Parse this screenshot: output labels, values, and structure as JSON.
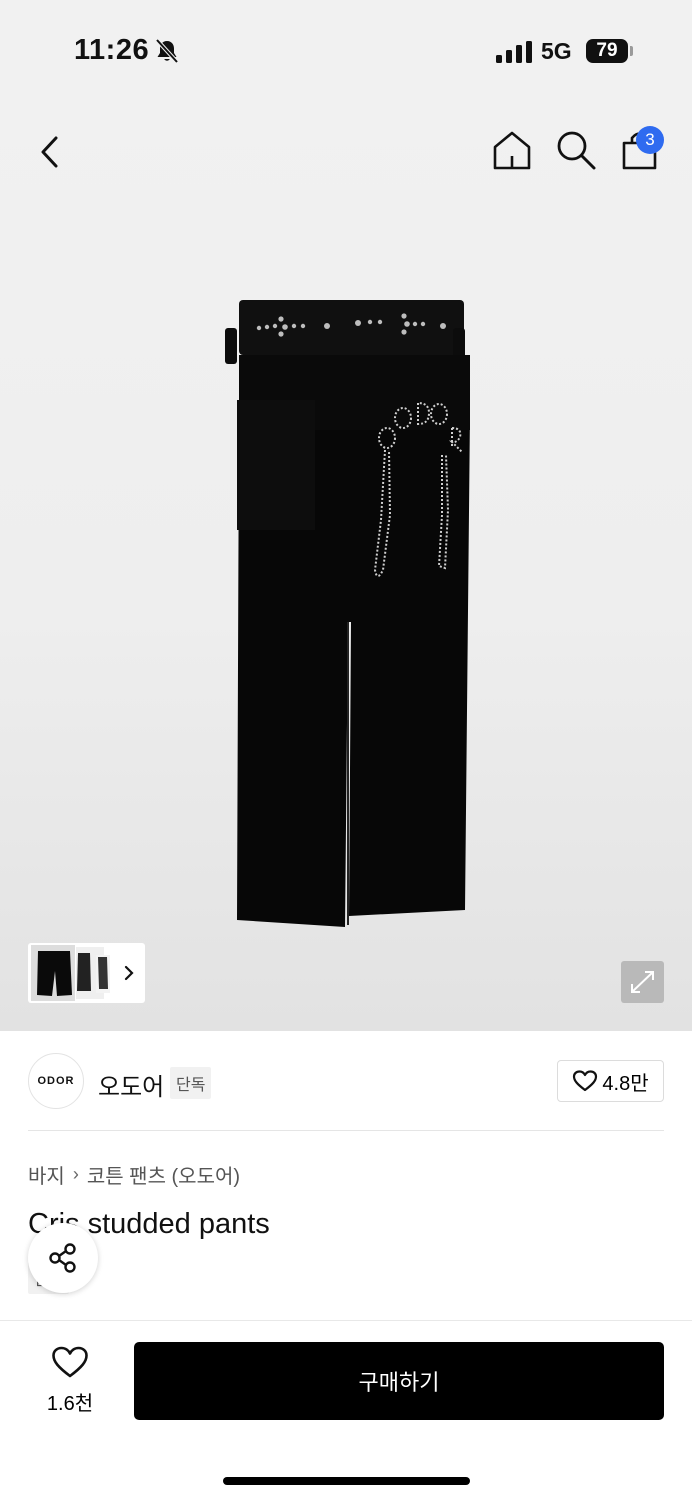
{
  "status_bar": {
    "time": "11:26",
    "network": "5G",
    "battery": "79"
  },
  "header": {
    "cart_count": "3"
  },
  "brand": {
    "logo_text": "ODOR",
    "name": "오도어",
    "tag": "단독",
    "like_count": "4.8만"
  },
  "breadcrumb": {
    "items": [
      "바지",
      "코튼 팬츠 (오도어)"
    ]
  },
  "product": {
    "title": "Cris studded pants",
    "tag": "단독"
  },
  "bottom_bar": {
    "like_count": "1.6천",
    "buy_label": "구매하기"
  },
  "colors": {
    "accent_badge": "#2f6bf0",
    "buy_button": "#000000"
  },
  "icons": [
    "bell-slash-icon",
    "signal-icon",
    "back-icon",
    "home-icon",
    "search-icon",
    "cart-icon",
    "chevron-right-icon",
    "expand-icon",
    "heart-icon",
    "share-icon"
  ]
}
